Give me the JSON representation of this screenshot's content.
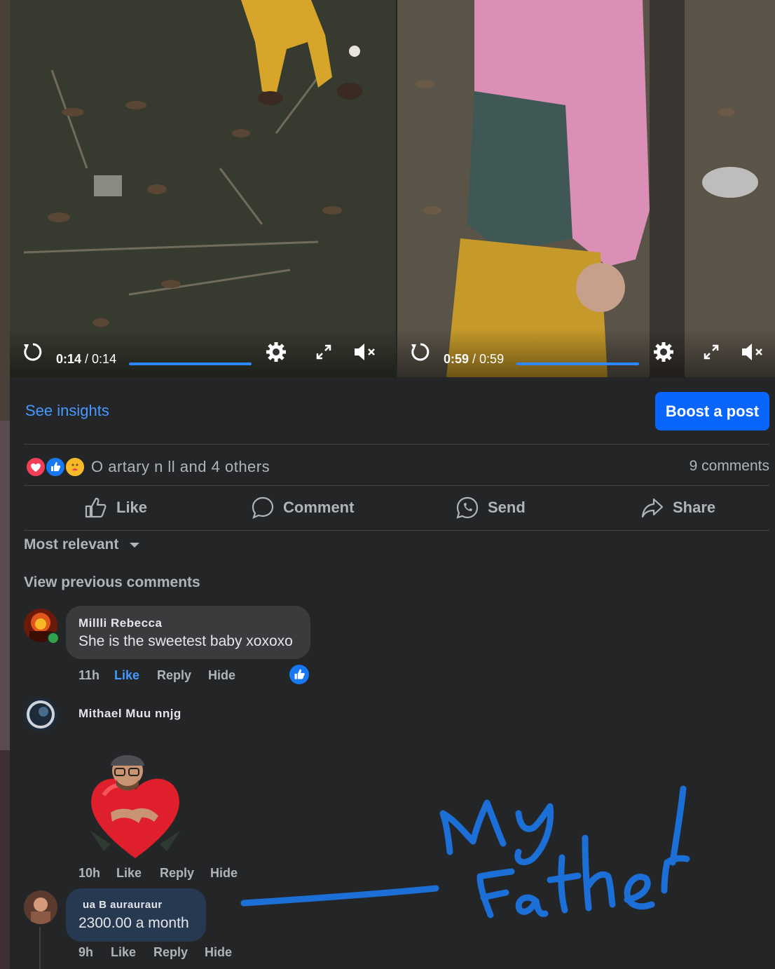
{
  "videos": [
    {
      "time_current": "0:14",
      "time_total": "0:14",
      "progress": 1.0
    },
    {
      "time_current": "0:59",
      "time_total": "0:59",
      "progress": 1.0
    }
  ],
  "insights": {
    "see_insights_label": "See insights",
    "boost_label": "Boost a post"
  },
  "reactions": {
    "icons": [
      "love-reaction-icon",
      "like-reaction-icon",
      "care-reaction-icon"
    ],
    "summary": "O artary n ll and 4 others",
    "comments_count": "9 comments"
  },
  "actions": {
    "like": "Like",
    "comment": "Comment",
    "send": "Send",
    "share": "Share"
  },
  "sort": {
    "label": "Most relevant"
  },
  "view_previous": "View previous comments",
  "comments": [
    {
      "author": "Millli Rebecca",
      "text": "She is the sweetest baby xoxoxo",
      "time": "11h",
      "like": "Like",
      "reply": "Reply",
      "hide": "Hide"
    },
    {
      "author": "Mithael Muu nnjg",
      "time": "10h",
      "like": "Like",
      "reply": "Reply",
      "hide": "Hide"
    },
    {
      "author": "ua B aurauraur",
      "text": "2300.00 a month",
      "time": "9h",
      "like": "Like",
      "reply": "Reply",
      "hide": "Hide"
    }
  ],
  "colors": {
    "background": "#242526",
    "accent": "#0866ff",
    "link": "#4599ff",
    "annotation": "#1b6fd6"
  }
}
